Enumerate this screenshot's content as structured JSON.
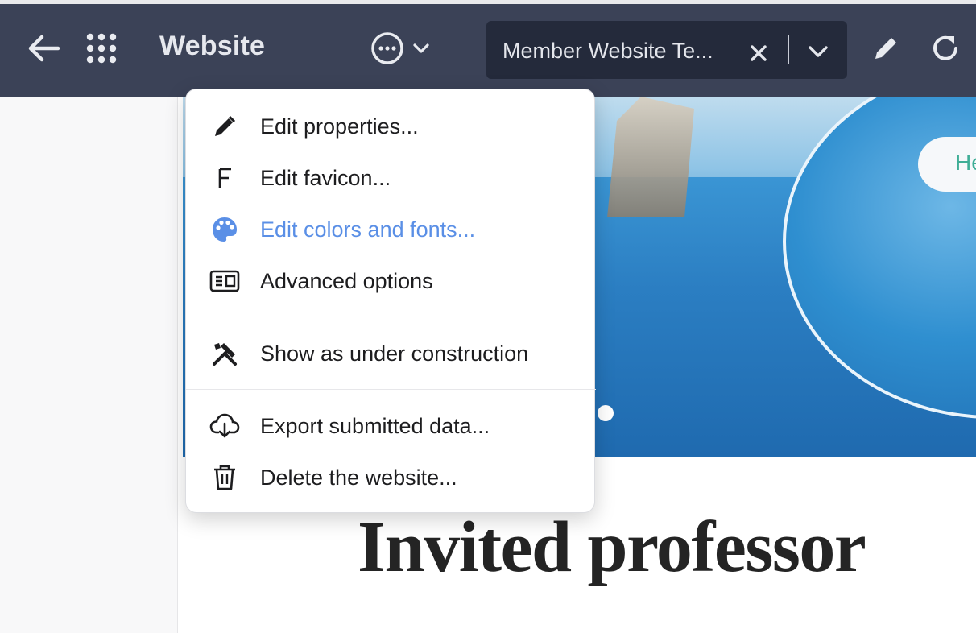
{
  "topbar": {
    "title": "Website",
    "website_selector": {
      "label": "Member Website Te..."
    },
    "icons": {
      "back": "arrow-left-icon",
      "apps": "apps-grid-icon",
      "more": "more-options-icon",
      "dropdown": "chevron-down-icon",
      "clear": "close-icon",
      "edit": "pencil-icon",
      "refresh": "refresh-icon"
    }
  },
  "menu": {
    "items": [
      {
        "label": "Edit properties...",
        "icon": "pencil-icon"
      },
      {
        "label": "Edit favicon...",
        "icon": "favicon-f-icon"
      },
      {
        "label": "Edit colors and fonts...",
        "icon": "palette-icon",
        "active": true
      },
      {
        "label": "Advanced options",
        "icon": "advanced-options-icon"
      },
      {
        "label": "Show as under construction",
        "icon": "tools-icon"
      },
      {
        "label": "Export submitted data...",
        "icon": "cloud-download-icon"
      },
      {
        "label": "Delete the website...",
        "icon": "trash-icon"
      }
    ]
  },
  "page": {
    "hero_button_label": "He",
    "heading": "Invited professor"
  },
  "colors": {
    "topbar_bg": "#3b4257",
    "selector_bg": "#242a3b",
    "active_item": "#5a8fe6",
    "heading": "#242424"
  }
}
